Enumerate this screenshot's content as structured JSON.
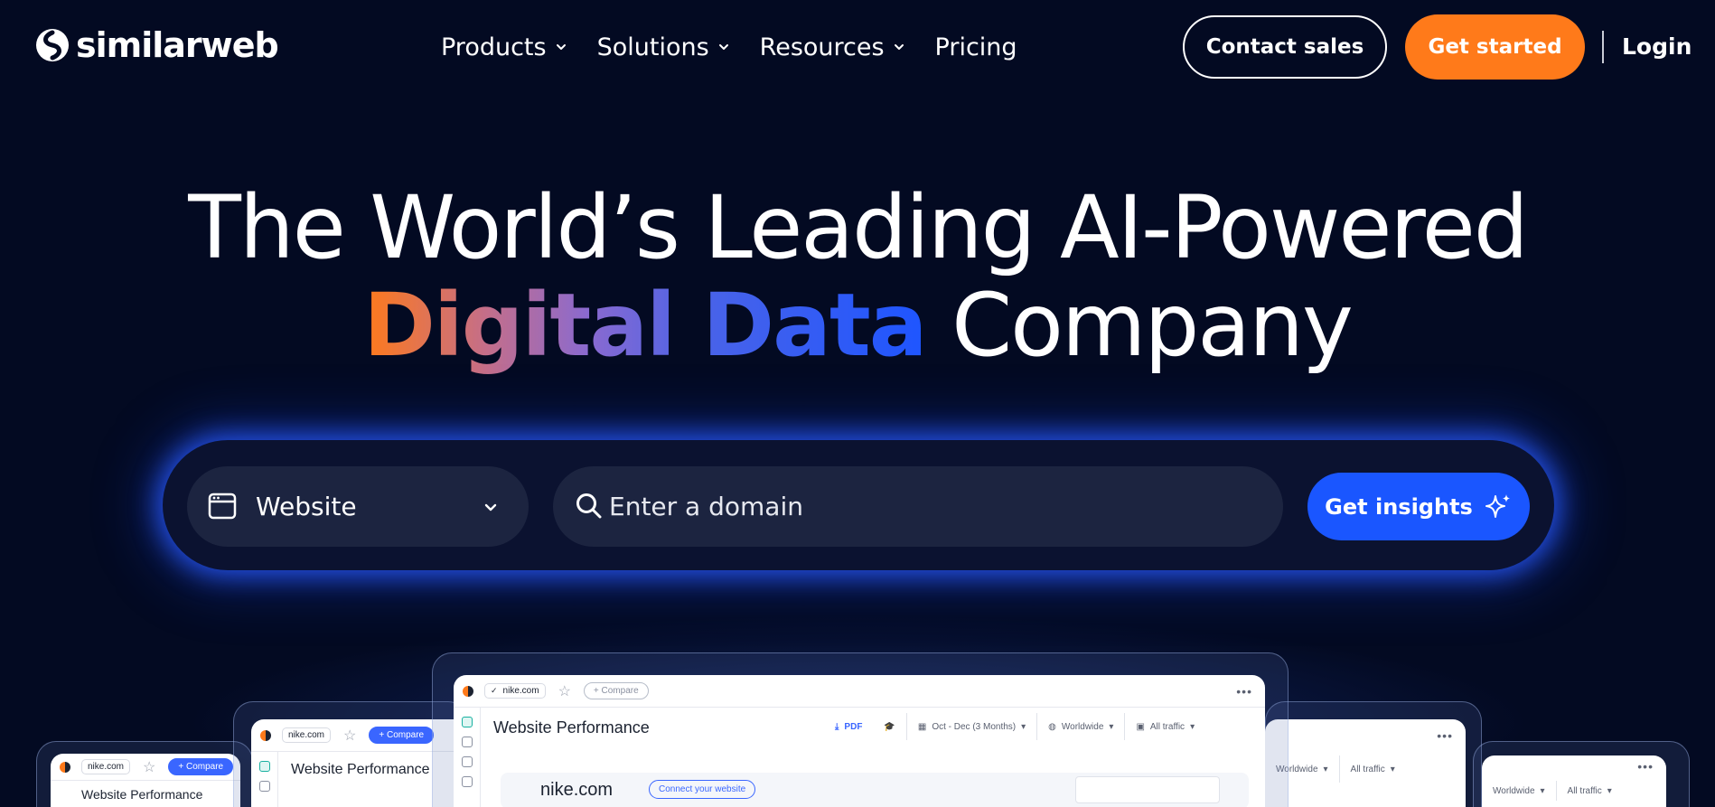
{
  "brand": {
    "name": "similarweb"
  },
  "nav": {
    "items": [
      {
        "label": "Products",
        "has_dropdown": true
      },
      {
        "label": "Solutions",
        "has_dropdown": true
      },
      {
        "label": "Resources",
        "has_dropdown": true
      },
      {
        "label": "Pricing",
        "has_dropdown": false
      }
    ],
    "contact_label": "Contact sales",
    "start_label": "Get started",
    "login_label": "Login"
  },
  "hero": {
    "line1": "The World’s Leading AI-Powered",
    "highlight": "Digital Data",
    "line2_rest": "Company"
  },
  "search": {
    "type_selected": "Website",
    "domain_placeholder": "Enter a domain",
    "submit_label": "Get insights"
  },
  "preview": {
    "site": "nike.com",
    "compare_label": "+ Compare",
    "title": "Website Performance",
    "pdf_label": "PDF",
    "date_range": "Oct - Dec (3 Months)",
    "region": "Worldwide",
    "traffic": "All traffic",
    "connect_label": "Connect your website"
  },
  "colors": {
    "background": "#030a22",
    "accent_orange": "#ff7a1a",
    "accent_blue": "#1a56ff",
    "field_bg": "#1c2440"
  },
  "icons": [
    "logo-mark-icon",
    "chevron-down-icon",
    "browser-window-icon",
    "search-icon",
    "sparkle-icon",
    "star-icon",
    "more-dots-icon"
  ]
}
